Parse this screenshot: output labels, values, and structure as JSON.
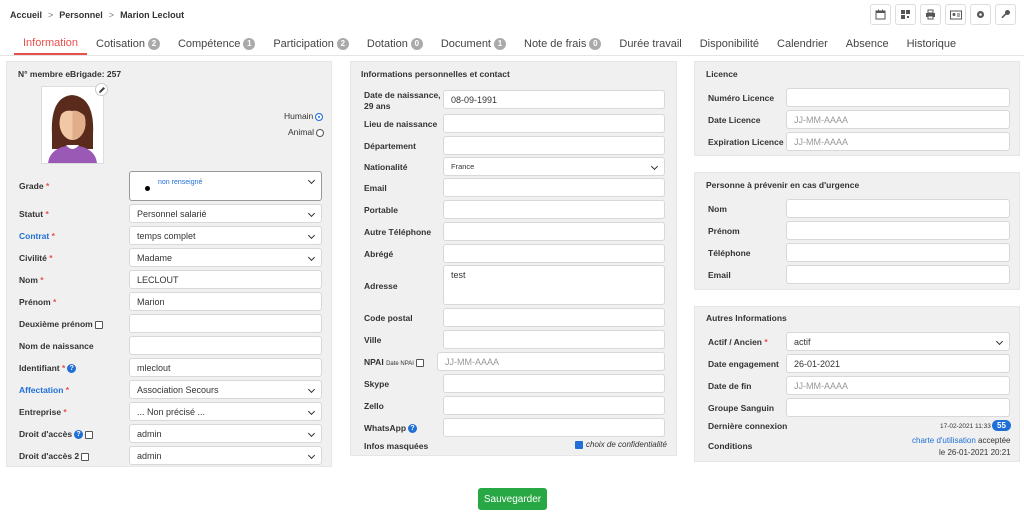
{
  "breadcrumb": {
    "home": "Accueil",
    "section": "Personnel",
    "current": "Marion Leclout",
    "sep": ">"
  },
  "tabs": [
    {
      "label": "Information",
      "badge": ""
    },
    {
      "label": "Cotisation",
      "badge": "2"
    },
    {
      "label": "Compétence",
      "badge": "1"
    },
    {
      "label": "Participation",
      "badge": "2"
    },
    {
      "label": "Dotation",
      "badge": "0"
    },
    {
      "label": "Document",
      "badge": "1"
    },
    {
      "label": "Note de frais",
      "badge": "0"
    },
    {
      "label": "Durée travail",
      "badge": ""
    },
    {
      "label": "Disponibilité",
      "badge": ""
    },
    {
      "label": "Calendrier",
      "badge": ""
    },
    {
      "label": "Absence",
      "badge": ""
    },
    {
      "label": "Historique",
      "badge": ""
    }
  ],
  "left": {
    "member_number": "N° membre eBrigade: 257",
    "humain": "Humain",
    "animal": "Animal",
    "grade_label": "Grade",
    "grade_value": "non renseigné",
    "statut_label": "Statut",
    "statut_value": "Personnel salarié",
    "contrat_label": "Contrat",
    "contrat_value": "temps complet",
    "civilite_label": "Civilité",
    "civilite_value": "Madame",
    "nom_label": "Nom",
    "nom_value": "LECLOUT",
    "prenom_label": "Prénom",
    "prenom_value": "Marion",
    "deuxieme_label": "Deuxième prénom",
    "deuxieme_value": "",
    "naissance_label": "Nom de naissance",
    "naissance_value": "",
    "identifiant_label": "Identifiant",
    "identifiant_value": "mleclout",
    "affectation_label": "Affectation",
    "affectation_value": "Association Secours",
    "entreprise_label": "Entreprise",
    "entreprise_value": "... Non précisé ...",
    "droit_label": "Droit d'accès",
    "droit_value": "admin",
    "droit2_label": "Droit d'accès 2",
    "droit2_value": "admin",
    "required_mark": "*"
  },
  "middle": {
    "title": "Informations personnelles et contact",
    "dob_label_1": "Date de naissance,",
    "dob_label_2": "29 ans",
    "dob_value": "08-09-1991",
    "lieu_label": "Lieu de naissance",
    "departement_label": "Département",
    "nationalite_label": "Nationalité",
    "nationalite_value": "France",
    "email_label": "Email",
    "portable_label": "Portable",
    "autre_tel_label": "Autre Téléphone",
    "abrege_label": "Abrégé",
    "adresse_label": "Adresse",
    "adresse_value": "test",
    "cp_label": "Code postal",
    "ville_label": "Ville",
    "npai_label": "NPAI",
    "npai_sub": "Date NPAI",
    "npai_placeholder": "JJ-MM-AAAA",
    "skype_label": "Skype",
    "zello_label": "Zello",
    "whatsapp_label": "WhatsApp",
    "infos_label": "Infos masquées",
    "conf_label": "choix de confidentialité"
  },
  "licence": {
    "title": "Licence",
    "numero_label": "Numéro Licence",
    "licence_label": "Date Licence",
    "licence_placeholder": "JJ-MM-AAAA",
    "expiration_label": "Expiration Licence",
    "expiration_placeholder": "JJ-MM-AAAA"
  },
  "urgence": {
    "title": "Personne à prévenir en cas d'urgence",
    "nom_label": "Nom",
    "prenom_label": "Prénom",
    "tel_label": "Téléphone",
    "email_label": "Email"
  },
  "autres": {
    "title": "Autres Informations",
    "actif_label": "Actif / Ancien",
    "actif_value": "actif",
    "engagement_label": "Date engagement",
    "engagement_value": "26-01-2021",
    "fin_label": "Date de fin",
    "fin_placeholder": "JJ-MM-AAAA",
    "sanguin_label": "Groupe Sanguin",
    "connexion_label": "Dernière connexion",
    "connexion_date": "17-02-2021 11:33",
    "connexion_count": "55",
    "conditions_label": "Conditions",
    "charte_link": "charte d'utilisation",
    "acceptee": "acceptée",
    "acceptee_date": "le 26-01-2021 20:21"
  },
  "save_label": "Sauvegarder",
  "colors": {
    "accent": "#e8514a",
    "link": "#1f6fd6",
    "save": "#28a745"
  }
}
